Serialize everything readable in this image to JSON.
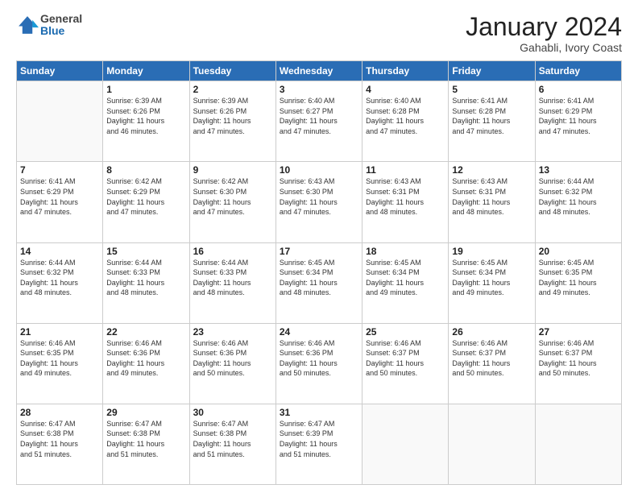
{
  "header": {
    "logo": {
      "general": "General",
      "blue": "Blue"
    },
    "title": "January 2024",
    "location": "Gahabli, Ivory Coast"
  },
  "weekdays": [
    "Sunday",
    "Monday",
    "Tuesday",
    "Wednesday",
    "Thursday",
    "Friday",
    "Saturday"
  ],
  "weeks": [
    [
      {
        "day": "",
        "info": ""
      },
      {
        "day": "1",
        "info": "Sunrise: 6:39 AM\nSunset: 6:26 PM\nDaylight: 11 hours\nand 46 minutes."
      },
      {
        "day": "2",
        "info": "Sunrise: 6:39 AM\nSunset: 6:26 PM\nDaylight: 11 hours\nand 47 minutes."
      },
      {
        "day": "3",
        "info": "Sunrise: 6:40 AM\nSunset: 6:27 PM\nDaylight: 11 hours\nand 47 minutes."
      },
      {
        "day": "4",
        "info": "Sunrise: 6:40 AM\nSunset: 6:28 PM\nDaylight: 11 hours\nand 47 minutes."
      },
      {
        "day": "5",
        "info": "Sunrise: 6:41 AM\nSunset: 6:28 PM\nDaylight: 11 hours\nand 47 minutes."
      },
      {
        "day": "6",
        "info": "Sunrise: 6:41 AM\nSunset: 6:29 PM\nDaylight: 11 hours\nand 47 minutes."
      }
    ],
    [
      {
        "day": "7",
        "info": "Sunrise: 6:41 AM\nSunset: 6:29 PM\nDaylight: 11 hours\nand 47 minutes."
      },
      {
        "day": "8",
        "info": "Sunrise: 6:42 AM\nSunset: 6:29 PM\nDaylight: 11 hours\nand 47 minutes."
      },
      {
        "day": "9",
        "info": "Sunrise: 6:42 AM\nSunset: 6:30 PM\nDaylight: 11 hours\nand 47 minutes."
      },
      {
        "day": "10",
        "info": "Sunrise: 6:43 AM\nSunset: 6:30 PM\nDaylight: 11 hours\nand 47 minutes."
      },
      {
        "day": "11",
        "info": "Sunrise: 6:43 AM\nSunset: 6:31 PM\nDaylight: 11 hours\nand 48 minutes."
      },
      {
        "day": "12",
        "info": "Sunrise: 6:43 AM\nSunset: 6:31 PM\nDaylight: 11 hours\nand 48 minutes."
      },
      {
        "day": "13",
        "info": "Sunrise: 6:44 AM\nSunset: 6:32 PM\nDaylight: 11 hours\nand 48 minutes."
      }
    ],
    [
      {
        "day": "14",
        "info": "Sunrise: 6:44 AM\nSunset: 6:32 PM\nDaylight: 11 hours\nand 48 minutes."
      },
      {
        "day": "15",
        "info": "Sunrise: 6:44 AM\nSunset: 6:33 PM\nDaylight: 11 hours\nand 48 minutes."
      },
      {
        "day": "16",
        "info": "Sunrise: 6:44 AM\nSunset: 6:33 PM\nDaylight: 11 hours\nand 48 minutes."
      },
      {
        "day": "17",
        "info": "Sunrise: 6:45 AM\nSunset: 6:34 PM\nDaylight: 11 hours\nand 48 minutes."
      },
      {
        "day": "18",
        "info": "Sunrise: 6:45 AM\nSunset: 6:34 PM\nDaylight: 11 hours\nand 49 minutes."
      },
      {
        "day": "19",
        "info": "Sunrise: 6:45 AM\nSunset: 6:34 PM\nDaylight: 11 hours\nand 49 minutes."
      },
      {
        "day": "20",
        "info": "Sunrise: 6:45 AM\nSunset: 6:35 PM\nDaylight: 11 hours\nand 49 minutes."
      }
    ],
    [
      {
        "day": "21",
        "info": "Sunrise: 6:46 AM\nSunset: 6:35 PM\nDaylight: 11 hours\nand 49 minutes."
      },
      {
        "day": "22",
        "info": "Sunrise: 6:46 AM\nSunset: 6:36 PM\nDaylight: 11 hours\nand 49 minutes."
      },
      {
        "day": "23",
        "info": "Sunrise: 6:46 AM\nSunset: 6:36 PM\nDaylight: 11 hours\nand 50 minutes."
      },
      {
        "day": "24",
        "info": "Sunrise: 6:46 AM\nSunset: 6:36 PM\nDaylight: 11 hours\nand 50 minutes."
      },
      {
        "day": "25",
        "info": "Sunrise: 6:46 AM\nSunset: 6:37 PM\nDaylight: 11 hours\nand 50 minutes."
      },
      {
        "day": "26",
        "info": "Sunrise: 6:46 AM\nSunset: 6:37 PM\nDaylight: 11 hours\nand 50 minutes."
      },
      {
        "day": "27",
        "info": "Sunrise: 6:46 AM\nSunset: 6:37 PM\nDaylight: 11 hours\nand 50 minutes."
      }
    ],
    [
      {
        "day": "28",
        "info": "Sunrise: 6:47 AM\nSunset: 6:38 PM\nDaylight: 11 hours\nand 51 minutes."
      },
      {
        "day": "29",
        "info": "Sunrise: 6:47 AM\nSunset: 6:38 PM\nDaylight: 11 hours\nand 51 minutes."
      },
      {
        "day": "30",
        "info": "Sunrise: 6:47 AM\nSunset: 6:38 PM\nDaylight: 11 hours\nand 51 minutes."
      },
      {
        "day": "31",
        "info": "Sunrise: 6:47 AM\nSunset: 6:39 PM\nDaylight: 11 hours\nand 51 minutes."
      },
      {
        "day": "",
        "info": ""
      },
      {
        "day": "",
        "info": ""
      },
      {
        "day": "",
        "info": ""
      }
    ]
  ]
}
